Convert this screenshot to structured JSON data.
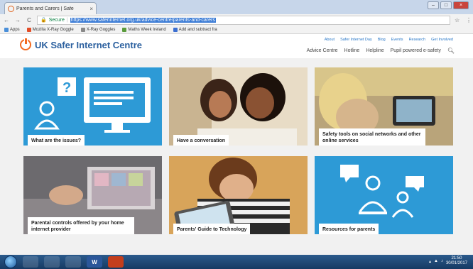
{
  "browser": {
    "tab_title": "Parents and Carers | Safe",
    "tab_close": "×",
    "window_buttons": [
      "–",
      "□",
      "×"
    ],
    "nav": {
      "back": "←",
      "forward": "→",
      "reload": "C"
    },
    "address": {
      "secure_label": "Secure",
      "url": "https://www.saferinternet.org.uk/advice-centre/parents-and-carers"
    },
    "bookmarks": [
      {
        "label": "Apps",
        "color": "#4a8fd9"
      },
      {
        "label": "Mozilla X-Ray Goggle",
        "color": "#e34c26"
      },
      {
        "label": "X-Ray Goggles",
        "color": "#888888"
      },
      {
        "label": "Maths Week Ireland",
        "color": "#5a9b3c"
      },
      {
        "label": "Add and subtract fra",
        "color": "#3b6fd1"
      }
    ]
  },
  "site": {
    "brand": "UK Safer Internet Centre",
    "top_links": [
      "About",
      "Safer Internet Day",
      "Blog",
      "Events",
      "Research",
      "Get Involved"
    ],
    "main_links": [
      "Advice Centre",
      "Hotline",
      "Helpline",
      "Pupil powered e-safety"
    ],
    "colors": {
      "accent": "#f26a21",
      "brand_blue": "#2a5f9e",
      "tile_blue": "#2d9ad6"
    }
  },
  "tiles": [
    {
      "caption": "What are the issues?"
    },
    {
      "caption": "Have a conversation"
    },
    {
      "caption": "Safety tools on social networks and other online services"
    },
    {
      "caption": "Parental controls offered by your home internet provider"
    },
    {
      "caption": "Parents' Guide to Technology"
    },
    {
      "caption": "Resources for parents"
    }
  ],
  "taskbar": {
    "apps": [
      "",
      "",
      "",
      "W",
      ""
    ],
    "clock_time": "21:50",
    "clock_date": "30/01/2017"
  }
}
